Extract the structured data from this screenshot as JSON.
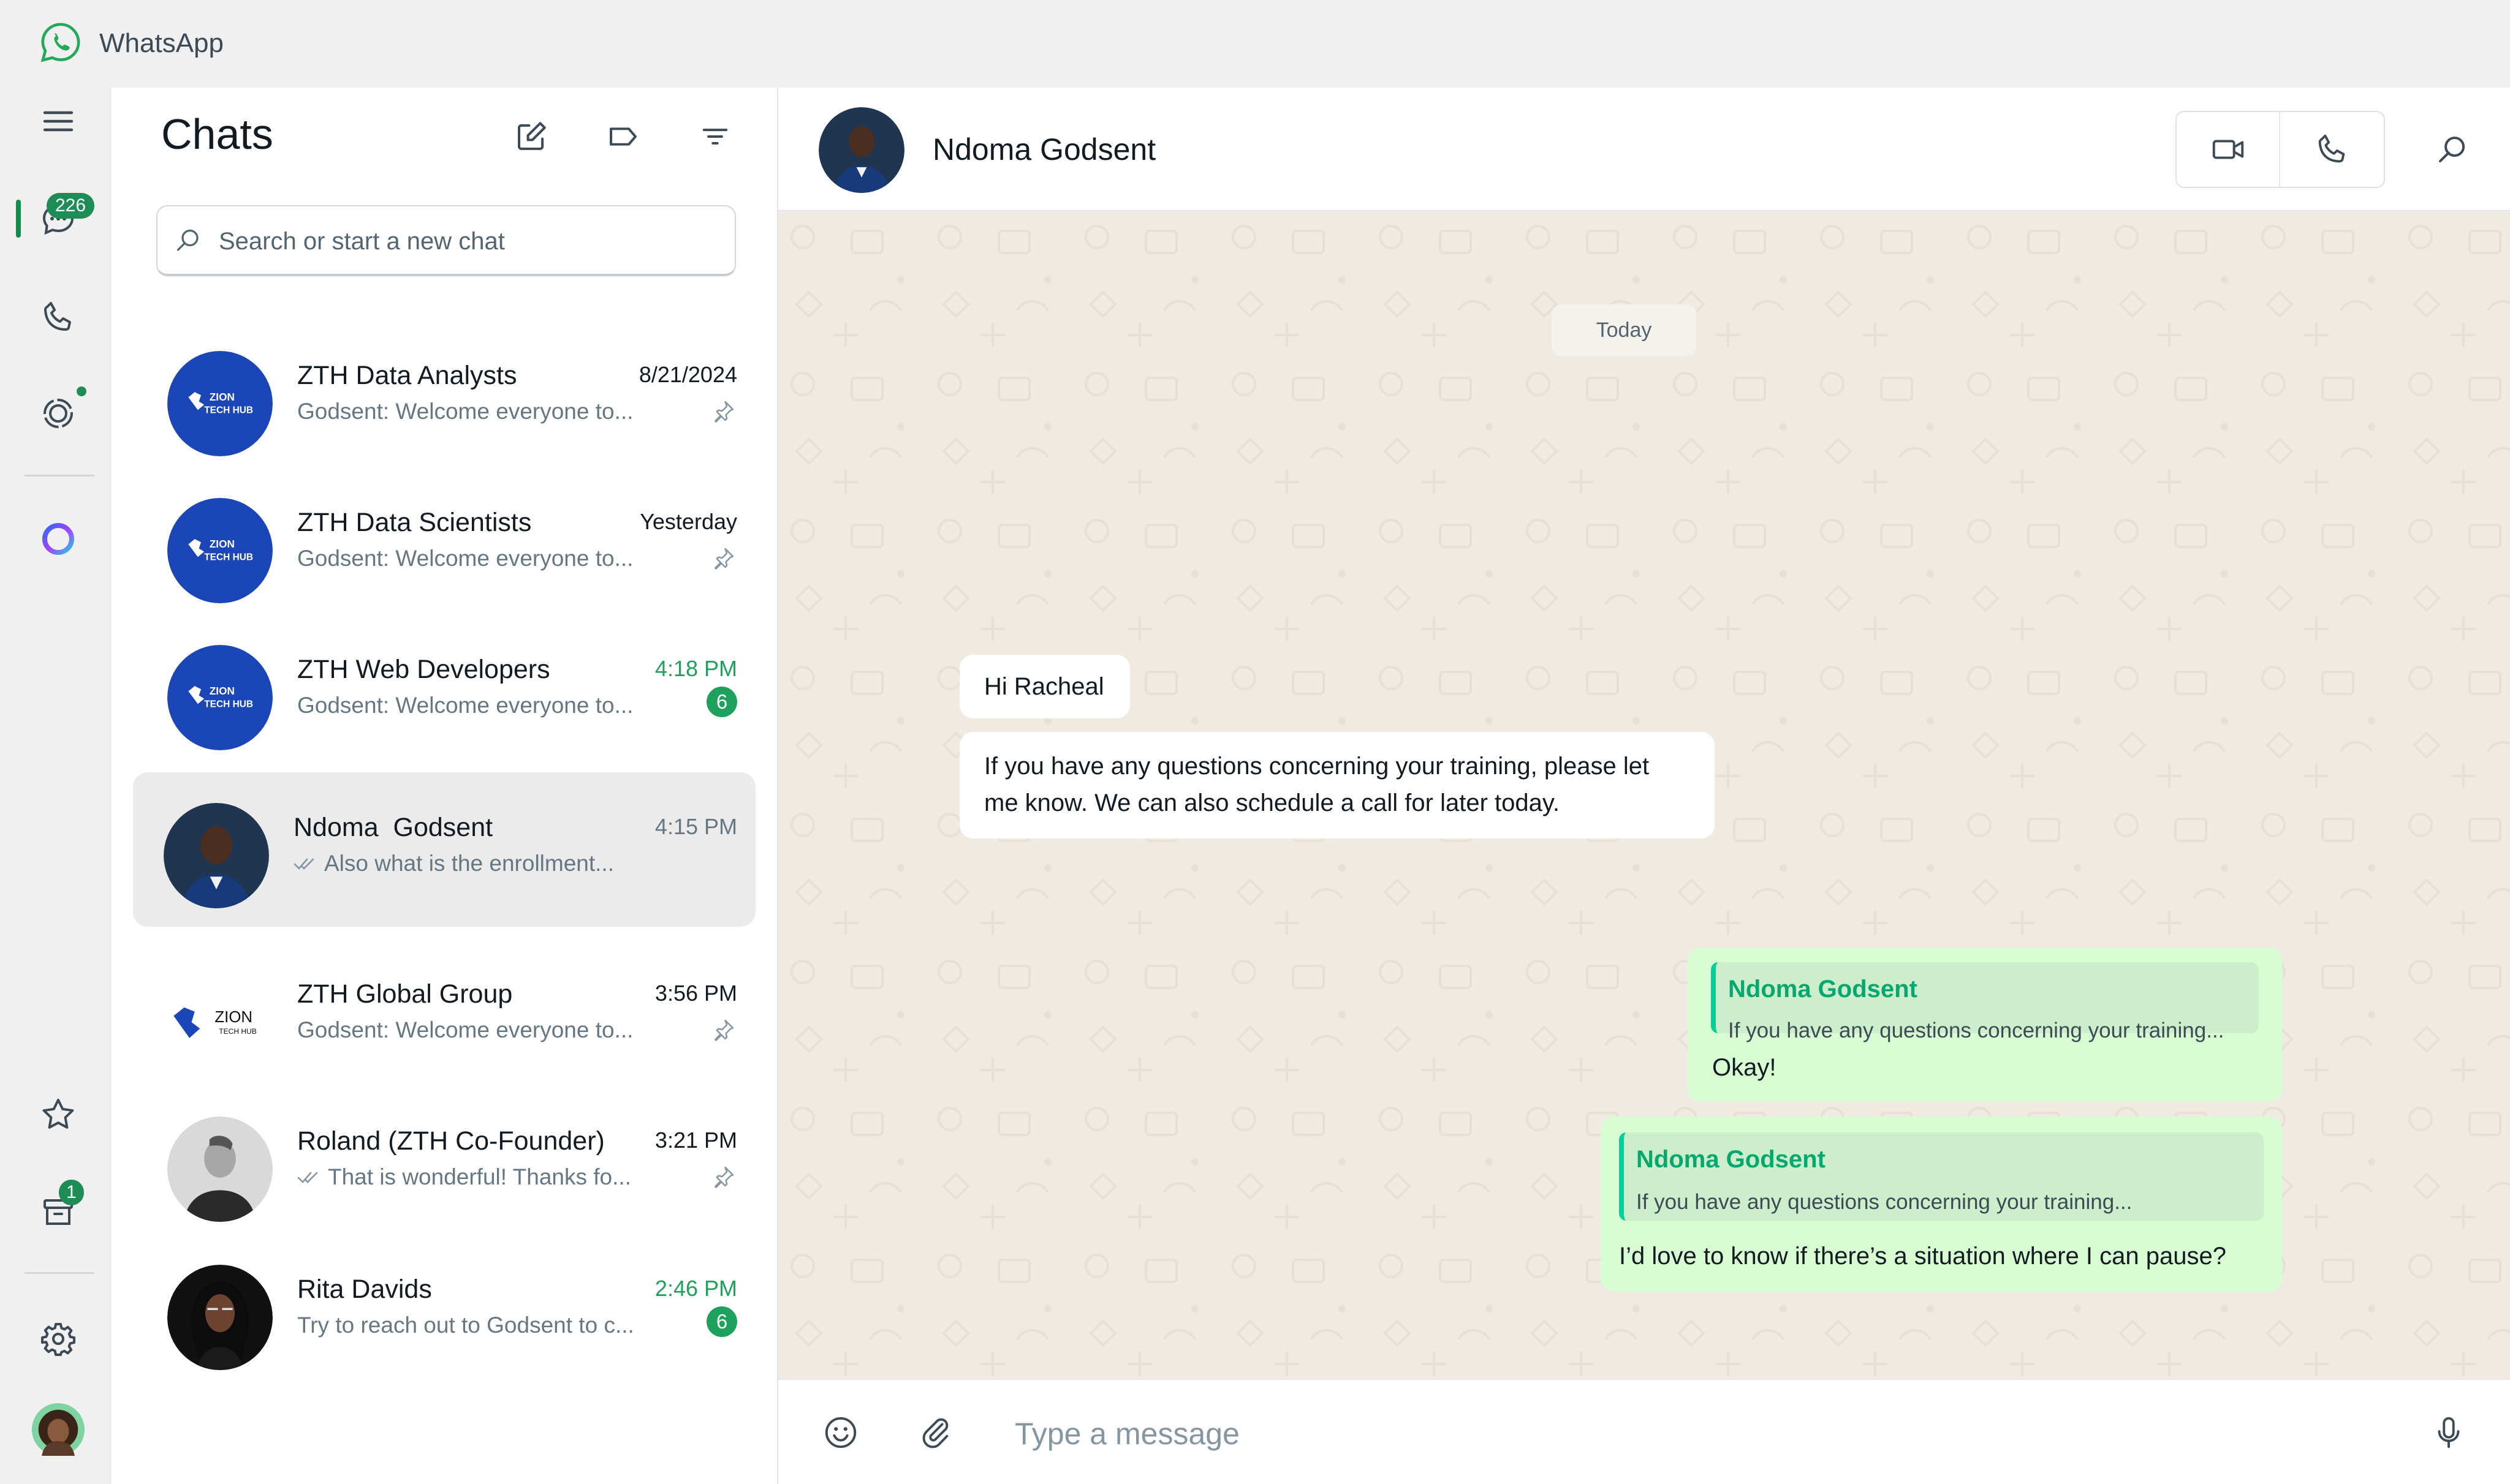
{
  "app": {
    "title": "WhatsApp"
  },
  "rail": {
    "chats_badge": "226",
    "archived_badge": "1"
  },
  "chat_list": {
    "heading": "Chats",
    "search_placeholder": "Search or start a new chat",
    "items": [
      {
        "name": "ZTH Data Analysts",
        "preview": "Godsent: Welcome everyone to...",
        "time": "8/21/2024",
        "pinned": true,
        "unread": "",
        "avatar": "zion-logo"
      },
      {
        "name": "ZTH Data Scientists",
        "preview": "Godsent: Welcome everyone to...",
        "time": "Yesterday",
        "pinned": true,
        "unread": "",
        "avatar": "zion-logo"
      },
      {
        "name": "ZTH Web Developers",
        "preview": "Godsent: Welcome everyone to...",
        "time": "4:18 PM",
        "pinned": false,
        "unread": "6",
        "avatar": "zion-logo"
      },
      {
        "name": "Ndoma  Godsent",
        "preview": "Also what is the enrollment...",
        "time": "4:15 PM",
        "pinned": false,
        "unread": "",
        "avatar": "person-photo",
        "selected": true,
        "read_ticks": true
      },
      {
        "name": "ZTH Global Group",
        "preview": "Godsent: Welcome everyone to...",
        "time": "3:56 PM",
        "pinned": true,
        "unread": "",
        "avatar": "zion-logo-white"
      },
      {
        "name": "Roland (ZTH Co-Founder)",
        "preview": "That is wonderful! Thanks fo...",
        "time": "3:21 PM",
        "pinned": true,
        "unread": "",
        "avatar": "person-photo",
        "read_ticks": true
      },
      {
        "name": "Rita Davids",
        "preview": "Try to reach out to Godsent to c...",
        "time": "2:46 PM",
        "pinned": false,
        "unread": "6",
        "avatar": "person-photo"
      }
    ],
    "zion_logo_text": {
      "line1": "ZION",
      "line2": "TECH HUB"
    }
  },
  "conversation": {
    "contact_name": "Ndoma Godsent",
    "date_chip": "Today",
    "messages": [
      {
        "direction": "in",
        "text": "Hi Racheal"
      },
      {
        "direction": "in",
        "text_line1": "If you have any questions concerning your training, please let",
        "text_line2": "me know. We can also schedule a call for later today."
      },
      {
        "direction": "out",
        "quote_name": "Ndoma Godsent",
        "quote_text": "If you have any questions concerning your training...",
        "text": "Okay!"
      },
      {
        "direction": "out",
        "quote_name": "Ndoma Godsent",
        "quote_text": "If you have any questions concerning your training...",
        "text": "I’d love to know if there’s a situation where I can pause?"
      }
    ],
    "composer_placeholder": "Type a message"
  },
  "colors": {
    "accent_green": "#1ea15d",
    "outgoing_bubble": "#d9fdd3",
    "chat_background": "#efeae2",
    "zion_blue": "#1b46b8"
  }
}
